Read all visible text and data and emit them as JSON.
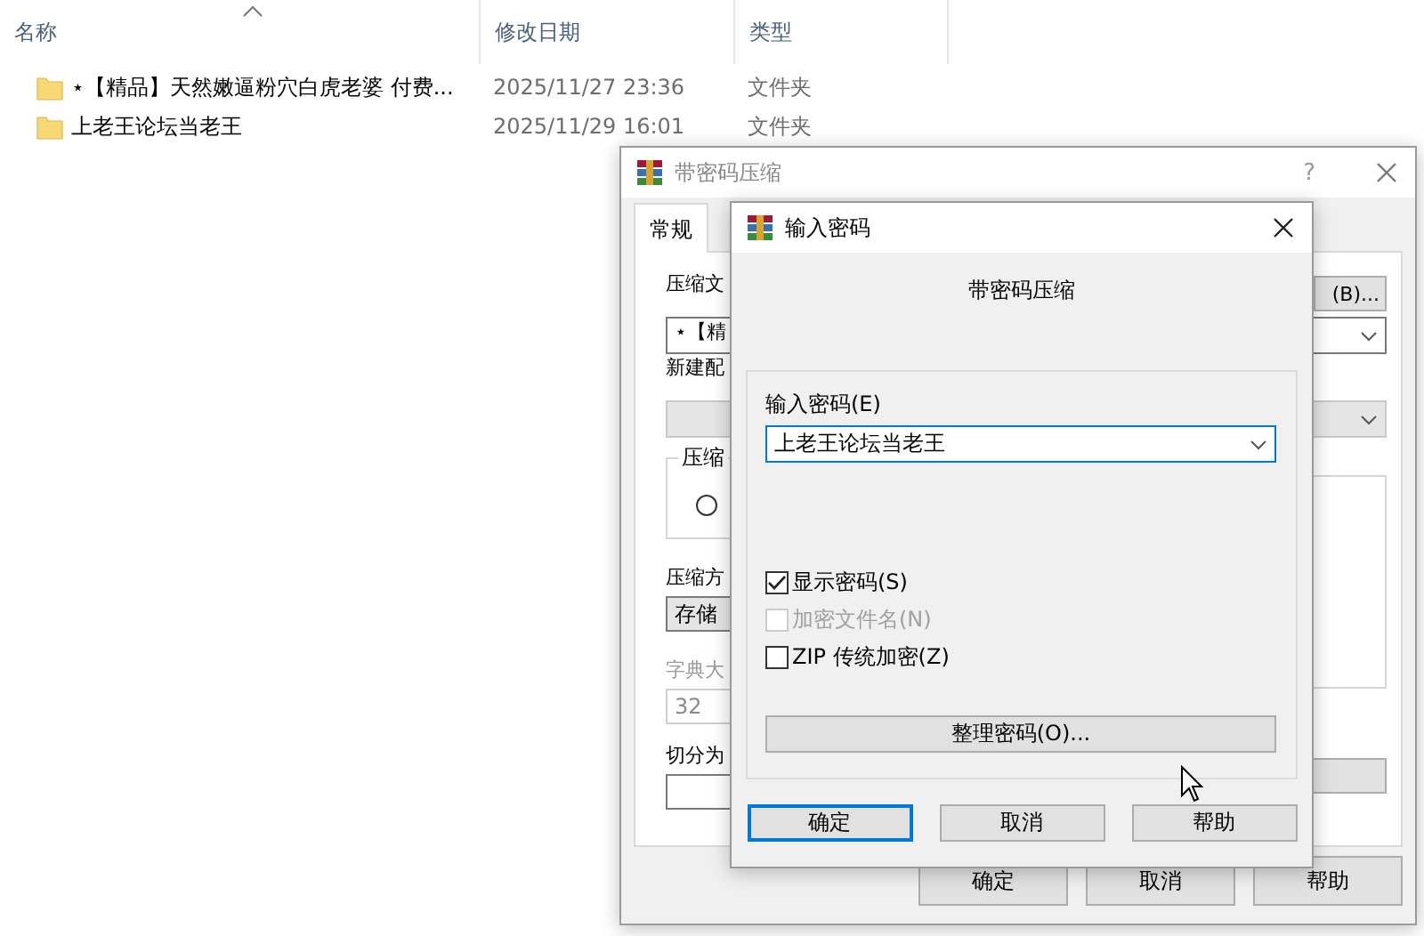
{
  "explorer": {
    "columns": [
      {
        "label": "名称"
      },
      {
        "label": "修改日期"
      },
      {
        "label": "类型"
      }
    ],
    "rows": [
      {
        "name": "⋆【精品】天然嫩逼粉穴白虎老婆 付费...",
        "modified": "2025/11/27 23:36",
        "type": "文件夹"
      },
      {
        "name": "上老王论坛当老王",
        "modified": "2025/11/29 16:01",
        "type": "文件夹"
      }
    ]
  },
  "back_dialog": {
    "title": "带密码压缩",
    "help": "?",
    "tabs": [
      {
        "label": "常规",
        "selected": true
      }
    ],
    "archive_label": "压缩文",
    "archive_value": "⋆【精",
    "browse_button": "(B)...",
    "profile_label": "新建配",
    "group_label": "压缩",
    "radio_selected": false,
    "method_label": "压缩方",
    "method_value": "存储",
    "dict_label": "字典大",
    "dict_value": "32",
    "split_label": "切分为",
    "buttons": [
      "确定",
      "取消",
      "帮助"
    ]
  },
  "password_dialog": {
    "title": "输入密码",
    "heading": "带密码压缩",
    "password_label": "输入密码(E)",
    "password_value": "上老王论坛当老王",
    "options": [
      {
        "label": "显示密码(S)",
        "checked": true,
        "disabled": false
      },
      {
        "label": "加密文件名(N)",
        "checked": false,
        "disabled": true
      },
      {
        "label": "ZIP 传统加密(Z)",
        "checked": false,
        "disabled": false
      }
    ],
    "manage_button": "整理密码(O)...",
    "buttons": [
      {
        "label": "确定",
        "selected": true
      },
      {
        "label": "取消",
        "selected": false
      },
      {
        "label": "帮助",
        "selected": false
      }
    ]
  }
}
